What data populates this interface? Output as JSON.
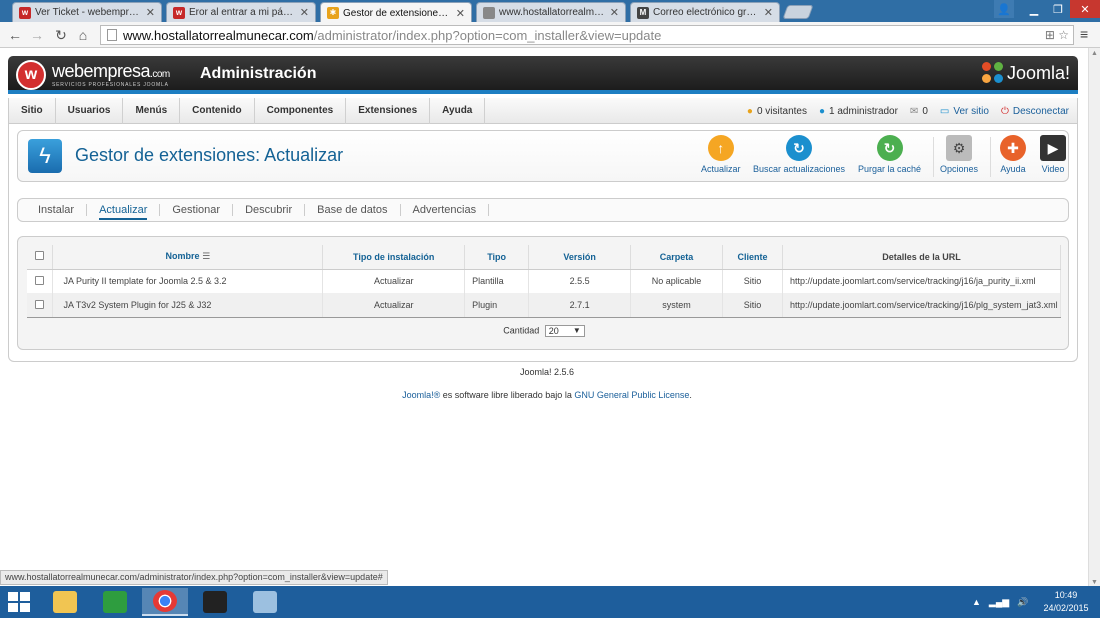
{
  "browser": {
    "tabs": [
      {
        "label": "Ver Ticket - webempresa.c",
        "fav": "w",
        "favicon": "webempresa-favicon"
      },
      {
        "label": "Eror al entrar a mi página",
        "fav": "w",
        "favicon": "webempresa-favicon"
      },
      {
        "label": "Gestor de extensiones - Ac",
        "fav": "j",
        "favicon": "joomla-favicon",
        "active": true
      },
      {
        "label": "www.hostallatorrealmune",
        "fav": "g",
        "favicon": "page-favicon"
      },
      {
        "label": "Correo electrónico gratuit",
        "fav": "m",
        "favicon": "mail-favicon"
      }
    ],
    "url_host": "www.hostallatorrealmunecar.com",
    "url_path": "/administrator/index.php?option=com_installer&view=update",
    "status_url": "www.hostallatorrealmunecar.com/administrator/index.php?option=com_installer&view=update#"
  },
  "header": {
    "brand": "webempresa",
    "brand_suffix": ".com",
    "brand_tagline": "SERVICIOS PROFESIONALES JOOMLA",
    "title": "Administración",
    "joomla_logo": "Joomla!"
  },
  "menu": {
    "items": [
      "Sitio",
      "Usuarios",
      "Menús",
      "Contenido",
      "Componentes",
      "Extensiones",
      "Ayuda"
    ],
    "status": {
      "visitors": "0 visitantes",
      "admins": "1 administrador",
      "messages": "0",
      "view_site": "Ver sitio",
      "logout": "Desconectar"
    }
  },
  "toolbar": {
    "page_title": "Gestor de extensiones: Actualizar",
    "buttons": {
      "update": "Actualizar",
      "find": "Buscar actualizaciones",
      "purge": "Purgar la caché",
      "options": "Opciones",
      "help": "Ayuda",
      "video": "Video"
    }
  },
  "subtabs": {
    "install": "Instalar",
    "update": "Actualizar",
    "manage": "Gestionar",
    "discover": "Descubrir",
    "database": "Base de datos",
    "warnings": "Advertencias"
  },
  "table": {
    "headers": {
      "name": "Nombre",
      "install_type": "Tipo de instalación",
      "type": "Tipo",
      "version": "Versión",
      "folder": "Carpeta",
      "client": "Cliente",
      "url": "Detalles de la URL"
    },
    "rows": [
      {
        "name": "JA Purity II template for Joomla 2.5 & 3.2",
        "install_type": "Actualizar",
        "type": "Plantilla",
        "version": "2.5.5",
        "folder": "No aplicable",
        "client": "Sitio",
        "url": "http://update.joomlart.com/service/tracking/j16/ja_purity_ii.xml"
      },
      {
        "name": "JA T3v2 System Plugin for J25 & J32",
        "install_type": "Actualizar",
        "type": "Plugin",
        "version": "2.7.1",
        "folder": "system",
        "client": "Sitio",
        "url": "http://update.joomlart.com/service/tracking/j16/plg_system_jat3.xml"
      }
    ],
    "limit_label": "Cantidad",
    "limit_value": "20"
  },
  "footer": {
    "version": "Joomla! 2.5.6",
    "license_brand": "Joomla!®",
    "license_text": " es software libre liberado bajo la ",
    "license_link": "GNU General Public License",
    "license_end": "."
  },
  "taskbar": {
    "time": "10:49",
    "date": "24/02/2015"
  },
  "colors": {
    "accent": "#146295",
    "header_bar": "#1d7ec2",
    "taskbar": "#1e5e9c"
  }
}
